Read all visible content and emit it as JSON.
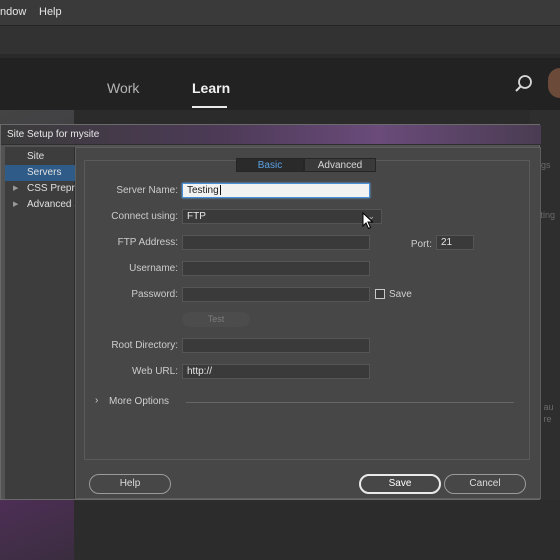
{
  "menubar": {
    "items": [
      "ndow",
      "Help"
    ]
  },
  "workspace": {
    "tabs": [
      "Work",
      "Learn"
    ],
    "active": "Learn"
  },
  "background_right": {
    "ghost_text": [
      "ngs",
      "sting",
      "e au",
      "e re"
    ]
  },
  "dialog": {
    "title": "Site Setup for mysite",
    "categories": [
      {
        "label": "Site",
        "selected": false,
        "expandable": false
      },
      {
        "label": "Servers",
        "selected": true,
        "expandable": false
      },
      {
        "label": "CSS Preprocessors",
        "selected": false,
        "expandable": true
      },
      {
        "label": "Advanced Settings",
        "selected": false,
        "expandable": true
      }
    ],
    "tabs": {
      "basic": "Basic",
      "advanced": "Advanced"
    },
    "fields": {
      "server_name": {
        "label": "Server Name:",
        "value": "Testing"
      },
      "connect_using": {
        "label": "Connect using:",
        "value": "FTP"
      },
      "ftp_address": {
        "label": "FTP Address:",
        "value": ""
      },
      "port": {
        "label": "Port:",
        "value": "21"
      },
      "username": {
        "label": "Username:",
        "value": ""
      },
      "password": {
        "label": "Password:",
        "value": ""
      },
      "save_checkbox": {
        "label": "Save",
        "checked": false
      },
      "test_button": "Test",
      "root_directory": {
        "label": "Root Directory:",
        "value": ""
      },
      "web_url": {
        "label": "Web URL:",
        "value": "http://"
      }
    },
    "more_options": "More Options",
    "buttons": {
      "help": "Help",
      "save": "Save",
      "cancel": "Cancel"
    }
  },
  "colors": {
    "selection": "#2f5b88",
    "tab_active_text": "#5aa0e6",
    "dialog_bg": "#474747"
  }
}
